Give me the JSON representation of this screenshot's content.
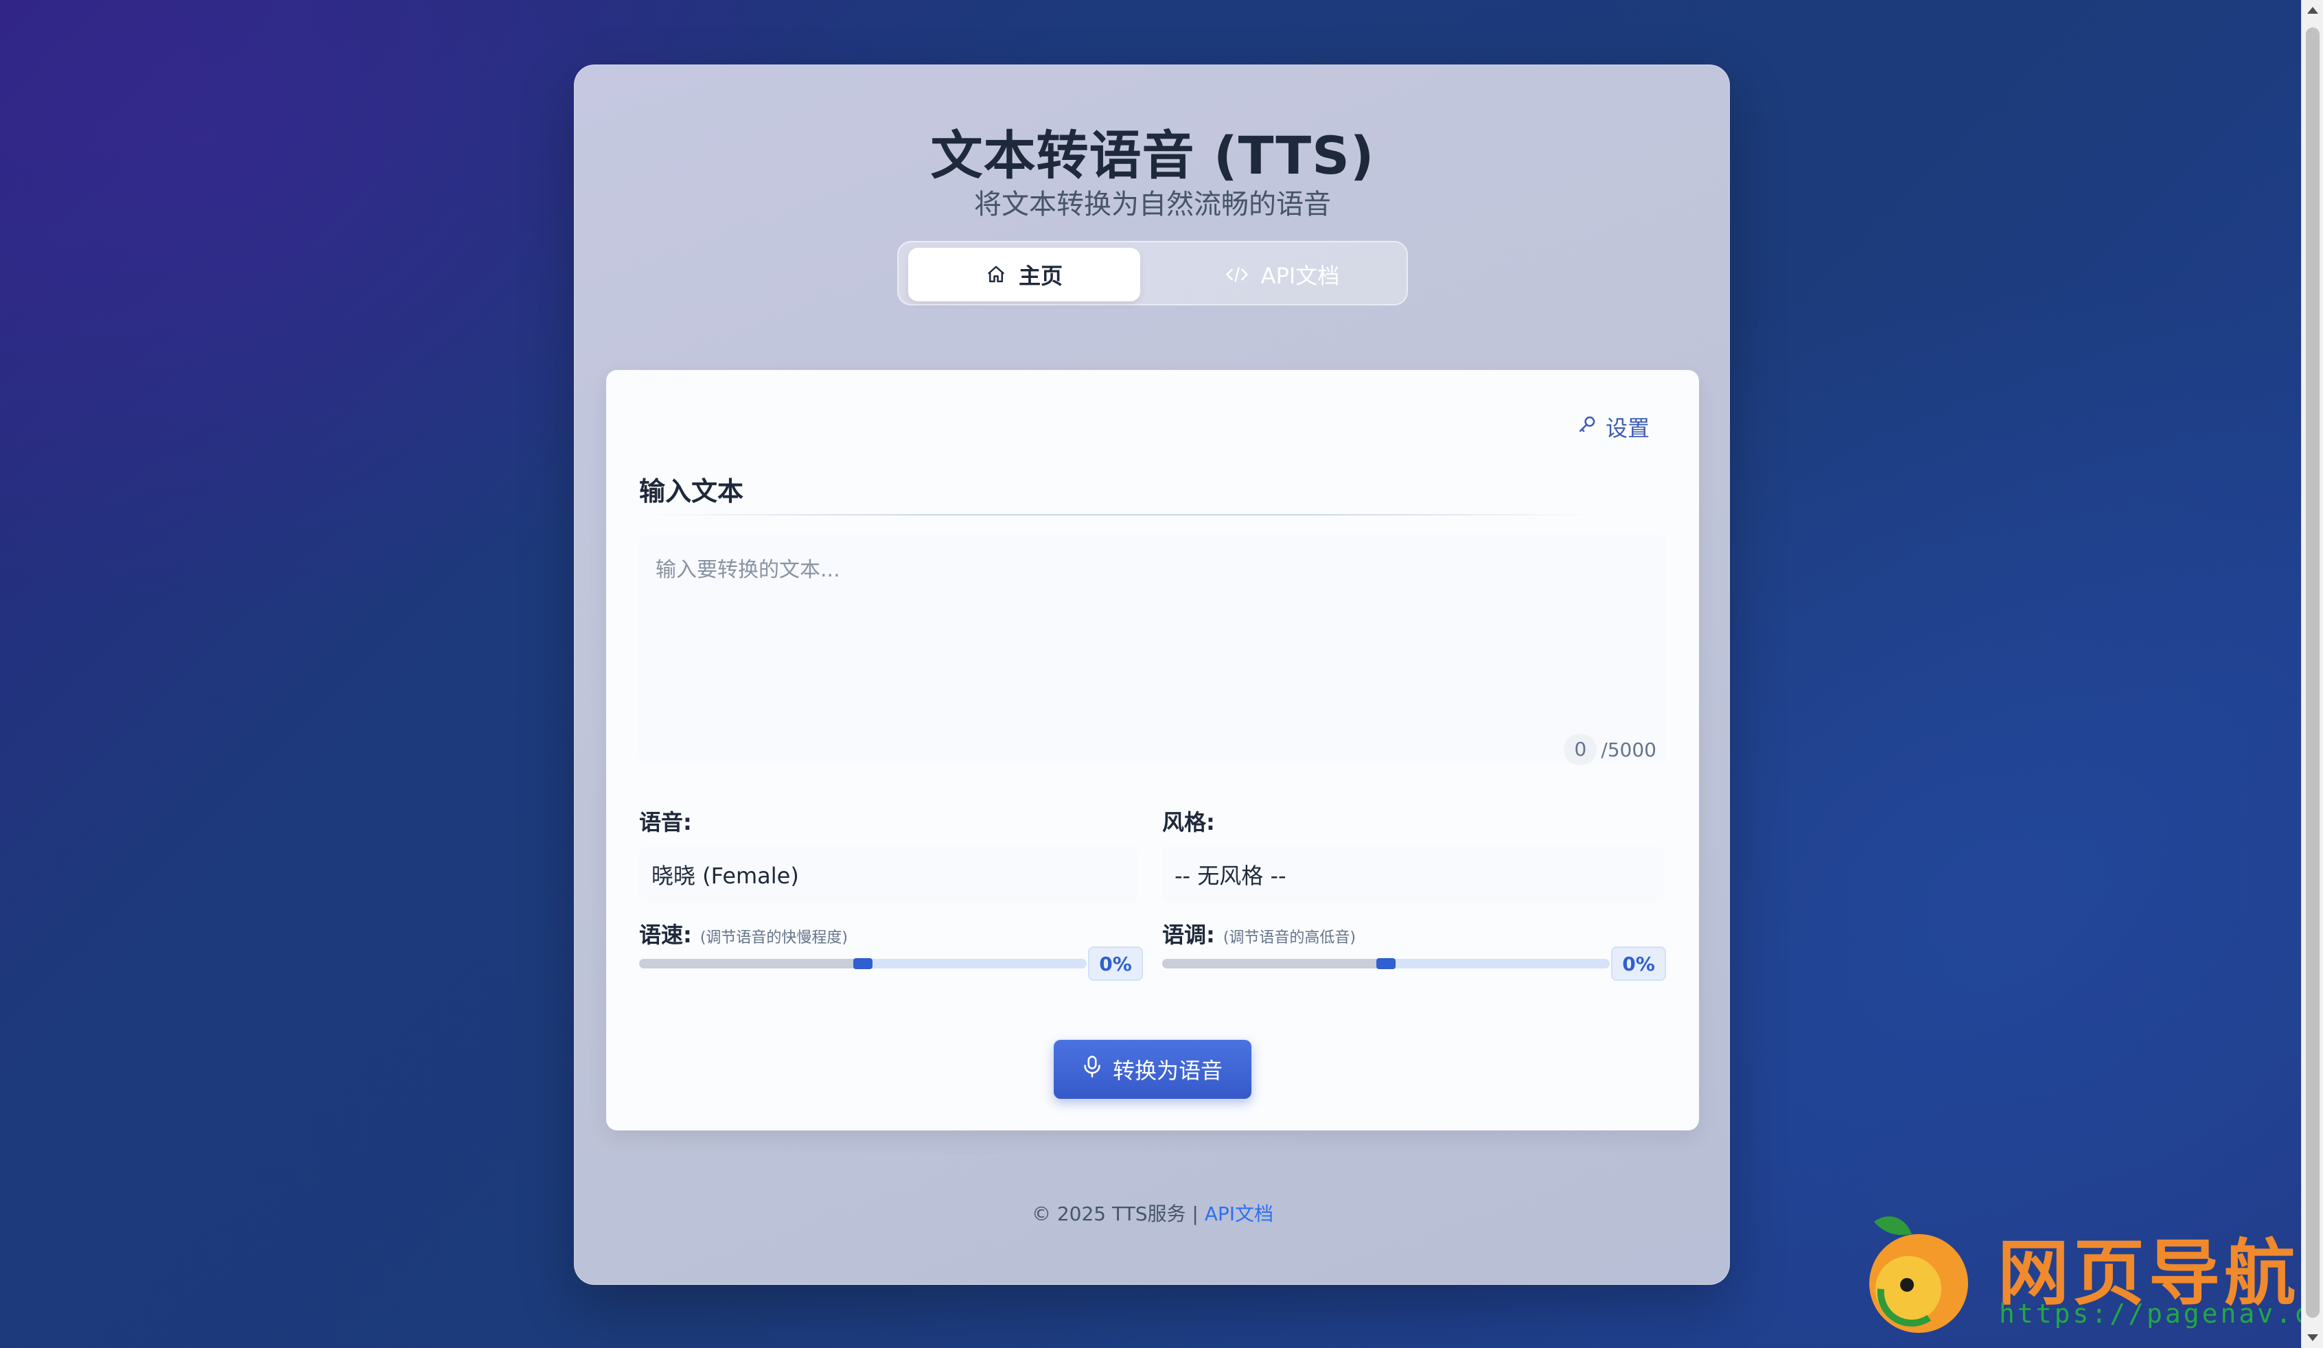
{
  "header": {
    "title": "文本转语音 (TTS)",
    "subtitle": "将文本转换为自然流畅的语音"
  },
  "tabs": [
    {
      "label": "主页",
      "icon": "home-icon",
      "active": true
    },
    {
      "label": "API文档",
      "icon": "code-icon",
      "active": false
    }
  ],
  "panel": {
    "settings_label": "设置",
    "section_title": "输入文本",
    "textarea": {
      "placeholder": "输入要转换的文本...",
      "value": ""
    },
    "char_count": {
      "current": "0",
      "max": "/5000"
    },
    "voice": {
      "label": "语音:",
      "selected": "晓晓 (Female)"
    },
    "style": {
      "label": "风格:",
      "selected": "-- 无风格 --"
    },
    "rate": {
      "label": "语速:",
      "hint": "(调节语音的快慢程度)",
      "value_text": "0%",
      "value": 0
    },
    "pitch": {
      "label": "语调:",
      "hint": "(调节语音的高低音)",
      "value_text": "0%",
      "value": 0
    },
    "convert_button": "转换为语音"
  },
  "footer": {
    "copyright": "© 2025 TTS服务 | ",
    "link": "API文档"
  },
  "watermark": {
    "text": "网页导航",
    "url": "https://pagenav.com"
  },
  "colors": {
    "accent": "#3659c9",
    "link": "#2f6ff0",
    "watermark_orange": "#f08a2c",
    "watermark_green": "#22a843"
  }
}
